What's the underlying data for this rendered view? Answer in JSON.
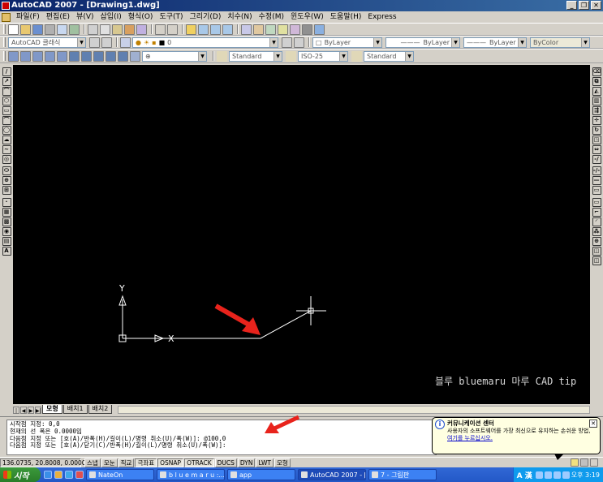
{
  "window": {
    "title": "AutoCAD 2007 - [Drawing1.dwg]",
    "controls": {
      "minimize": "_",
      "restore": "❐",
      "close": "✕"
    }
  },
  "menubar": [
    {
      "label": "파일(F)"
    },
    {
      "label": "편집(E)"
    },
    {
      "label": "뷰(V)"
    },
    {
      "label": "삽입(I)"
    },
    {
      "label": "형식(O)"
    },
    {
      "label": "도구(T)"
    },
    {
      "label": "그리기(D)"
    },
    {
      "label": "치수(N)"
    },
    {
      "label": "수정(M)"
    },
    {
      "label": "윈도우(W)"
    },
    {
      "label": "도움말(H)"
    },
    {
      "label": "Express"
    }
  ],
  "toolbars": {
    "workspace_combo": "AutoCAD 클래식",
    "layer_combo": "0",
    "color_combo": "ByLayer",
    "linetype_combo": "ByLayer",
    "lineweight_combo": "ByLayer",
    "plotstyle_combo": "ByColor",
    "textstyle_combo": "Standard",
    "dimstyle_combo": "ISO-25",
    "tablestyle_combo": "Standard"
  },
  "draw_tools_left": [
    "/",
    "↗",
    "⌒",
    "⬡",
    "▭",
    "⌒",
    "◯",
    "☁",
    "∼",
    "◎",
    "⬭",
    "⊕",
    "⊞",
    "·",
    "▦",
    "▩",
    "◉",
    "▤",
    "A"
  ],
  "modify_tools_right": [
    "⌫",
    "⧉",
    "◭",
    "▥",
    "⇶",
    "✛",
    "↻",
    "◳",
    "⇔",
    "-/",
    "-/-",
    "—",
    "▭",
    "▭",
    "⌐",
    "◜",
    "⁂",
    "⊕",
    "◫",
    "◫"
  ],
  "drawing": {
    "ucs_x_label": "X",
    "ucs_y_label": "Y",
    "watermark": "블루 bluemaru 마루 CAD tip",
    "arrow_color": "#e8231c",
    "line_color": "#ffffff"
  },
  "tabs": {
    "nav": [
      "|◀",
      "◀",
      "▶",
      "▶|"
    ],
    "items": [
      {
        "label": "모형",
        "active": true
      },
      {
        "label": "배치1",
        "active": false
      },
      {
        "label": "배치2",
        "active": false
      }
    ]
  },
  "command_line": {
    "lines": [
      "시작점 지정: 0,0",
      "현재의 선 폭은 0.0000임",
      "다음점 지정 또는 [호(A)/반폭(H)/길이(L)/명령 취소(U)/폭(W)]: @100,0",
      "다음점 지정 또는 [호(A)/닫기(C)/반폭(H)/길이(L)/명령 취소(U)/폭(W)]:"
    ]
  },
  "balloon": {
    "title": "커뮤니케이션 센터",
    "body": "사용자의 소프트웨어를 가장 최신으로 유지하는 손쉬운 방법,",
    "link": "여기를 누르십시오.",
    "close": "✕"
  },
  "statusbar": {
    "coords": "136.0735, 20.8008, 0.0000",
    "buttons": [
      {
        "label": "스냅",
        "on": false
      },
      {
        "label": "모눈",
        "on": false
      },
      {
        "label": "직교",
        "on": false
      },
      {
        "label": "극좌표",
        "on": true
      },
      {
        "label": "OSNAP",
        "on": true
      },
      {
        "label": "OTRACK",
        "on": true
      },
      {
        "label": "DUCS",
        "on": false
      },
      {
        "label": "DYN",
        "on": false
      },
      {
        "label": "LWT",
        "on": false
      },
      {
        "label": "모형",
        "on": false
      }
    ]
  },
  "taskbar": {
    "start": "시작",
    "tasks": [
      {
        "label": "NateOn",
        "active": false
      },
      {
        "label": "b l u e m a r u :...",
        "active": false
      },
      {
        "label": "app",
        "active": false
      },
      {
        "label": "AutoCAD 2007 - [...",
        "active": true
      },
      {
        "label": "7 - 그림판",
        "active": false
      }
    ],
    "tray": {
      "lang": "A 漢",
      "clock": "오후 3:19"
    }
  }
}
